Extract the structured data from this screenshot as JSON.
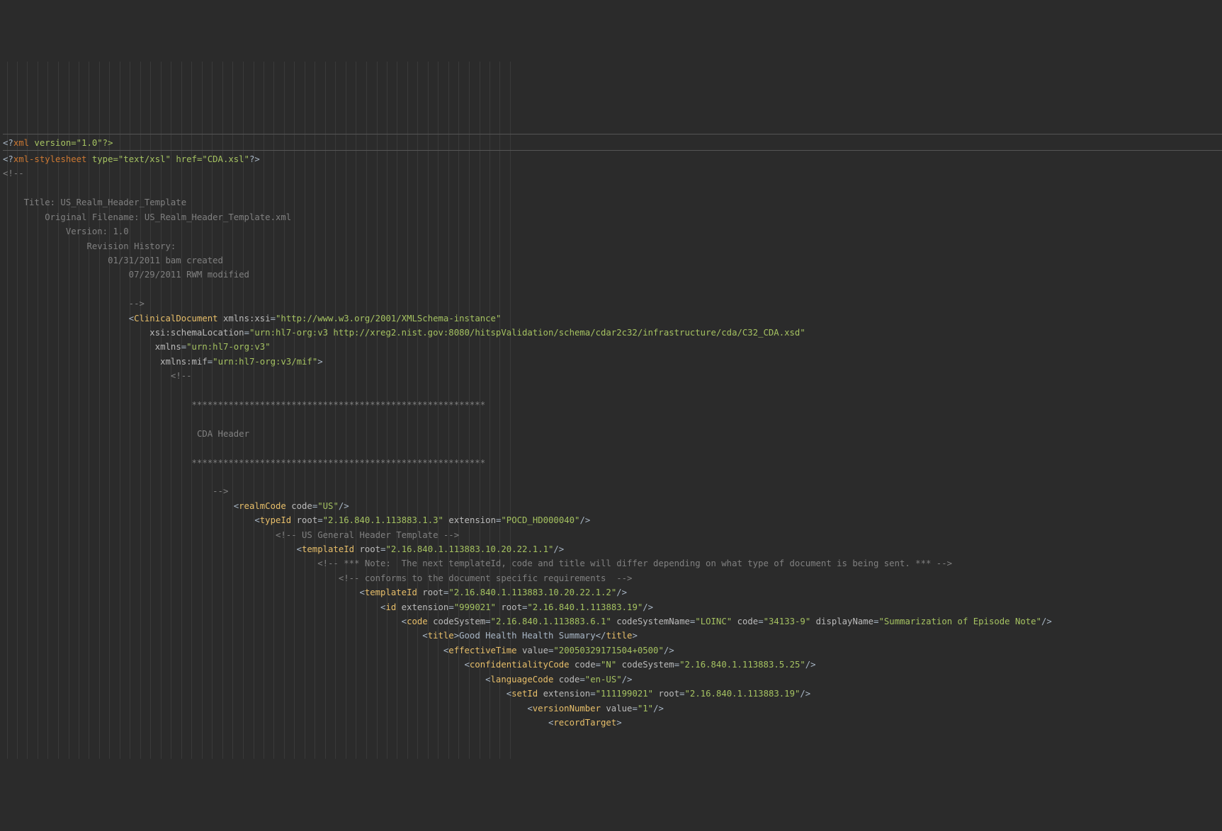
{
  "lines": {
    "l1_open": "<?",
    "l1_pi": "xml",
    "l1_rest": " version=\"1.0\"?>",
    "l2_open": "<?",
    "l2_pi": "xml-stylesheet",
    "l2_attrs": " type=\"text/xsl\" href=\"CDA.xsl\"",
    "l2_close": "?>",
    "l3": "<!--",
    "l4": "    Title: US_Realm_Header_Template",
    "l5": "        Original Filename: US_Realm_Header_Template.xml",
    "l6": "            Version: 1.0",
    "l7": "                Revision History:",
    "l8": "                    01/31/2011 bam created",
    "l9": "                        07/29/2011 RWM modified",
    "l10": "                        -->",
    "cd_indent": "                        ",
    "cd_tag": "ClinicalDocument",
    "cd_attr1_n": "xmlns:xsi",
    "cd_attr1_v": "http://www.w3.org/2001/XMLSchema-instance",
    "cd_line2_indent": "                            ",
    "cd_attr2_n": "xsi:schemaLocation",
    "cd_attr2_v": "urn:hl7-org:v3 http://xreg2.nist.gov:8080/hitspValidation/schema/cdar2c32/infrastructure/cda/C32_CDA.xsd",
    "cd_line3_indent": "                             ",
    "cd_attr3_n": "xmlns",
    "cd_attr3_v": "urn:hl7-org:v3",
    "cd_line4_indent": "                              ",
    "cd_attr4_n": "xmlns:mif",
    "cd_attr4_v": "urn:hl7-org:v3/mif",
    "inner_cmt_open_indent": "                                ",
    "inner_cmt_open": "<!--",
    "stars1_indent": "                                    ",
    "stars": "********************************************************",
    "cda_hdr_indent": "                                     ",
    "cda_hdr_text": "CDA Header",
    "stars2_indent": "                                    ",
    "cmt_close_indent": "                                        ",
    "cmt_close": "-->",
    "realm_indent": "                                            ",
    "realm_tag": "realmCode",
    "realm_attr_n": "code",
    "realm_attr_v": "US",
    "typeId_indent": "                                                ",
    "typeId_tag": "typeId",
    "typeId_a1n": "root",
    "typeId_a1v": "2.16.840.1.113883.1.3",
    "typeId_a2n": "extension",
    "typeId_a2v": "POCD_HD000040",
    "usgen_indent": "                                                    ",
    "usgen_cmt": "<!-- US General Header Template -->",
    "templ1_indent": "                                                        ",
    "templ1_tag": "templateId",
    "templ1_a1n": "root",
    "templ1_a1v": "2.16.840.1.113883.10.20.22.1.1",
    "note_indent": "                                                            ",
    "note_cmt": "<!-- *** Note:  The next templateId, code and title will differ depending on what type of document is being sent. *** -->",
    "conf_indent": "                                                                ",
    "conf_cmt": "<!-- conforms to the document specific requirements  -->",
    "templ2_indent": "                                                                    ",
    "templ2_tag": "templateId",
    "templ2_a1n": "root",
    "templ2_a1v": "2.16.840.1.113883.10.20.22.1.2",
    "id_indent": "                                                                        ",
    "id_tag": "id",
    "id_a1n": "extension",
    "id_a1v": "999021",
    "id_a2n": "root",
    "id_a2v": "2.16.840.1.113883.19",
    "code_indent": "                                                                            ",
    "code_tag": "code",
    "code_a1n": "codeSystem",
    "code_a1v": "2.16.840.1.113883.6.1",
    "code_a2n": "codeSystemName",
    "code_a2v": "LOINC",
    "code_a3n": "code",
    "code_a3v": "34133-9",
    "code_a4n": "displayName",
    "code_a4v": "Summarization of Episode Note",
    "title_indent": "                                                                                ",
    "title_tag": "title",
    "title_text": "Good Health Health Summary",
    "eff_indent": "                                                                                    ",
    "eff_tag": "effectiveTime",
    "eff_a1n": "value",
    "eff_a1v": "20050329171504+0500",
    "conf2_indent": "                                                                                        ",
    "conf2_tag": "confidentialityCode",
    "conf2_a1n": "code",
    "conf2_a1v": "N",
    "conf2_a2n": "codeSystem",
    "conf2_a2v": "2.16.840.1.113883.5.25",
    "lang_indent": "                                                                                            ",
    "lang_tag": "languageCode",
    "lang_a1n": "code",
    "lang_a1v": "en-US",
    "setId_indent": "                                                                                                ",
    "setId_tag": "setId",
    "setId_a1n": "extension",
    "setId_a1v": "111199021",
    "setId_a2n": "root",
    "setId_a2v": "2.16.840.1.113883.19",
    "ver_indent": "                                                                                                    ",
    "ver_tag": "versionNumber",
    "ver_a1n": "value",
    "ver_a1v": "1",
    "rec_indent": "                                                                                                        ",
    "rec_tag": "recordTarget"
  },
  "guides": [
    6,
    20,
    34,
    49,
    63,
    78,
    93,
    107,
    121,
    136,
    150,
    165,
    179,
    194,
    208,
    223,
    237,
    252,
    266,
    281,
    295,
    310,
    324,
    339,
    354,
    368,
    382,
    397,
    411,
    426,
    440,
    455,
    469,
    484,
    498,
    513,
    528,
    542,
    556,
    571,
    585,
    600,
    614,
    629,
    643,
    658,
    673,
    687,
    701,
    716
  ]
}
